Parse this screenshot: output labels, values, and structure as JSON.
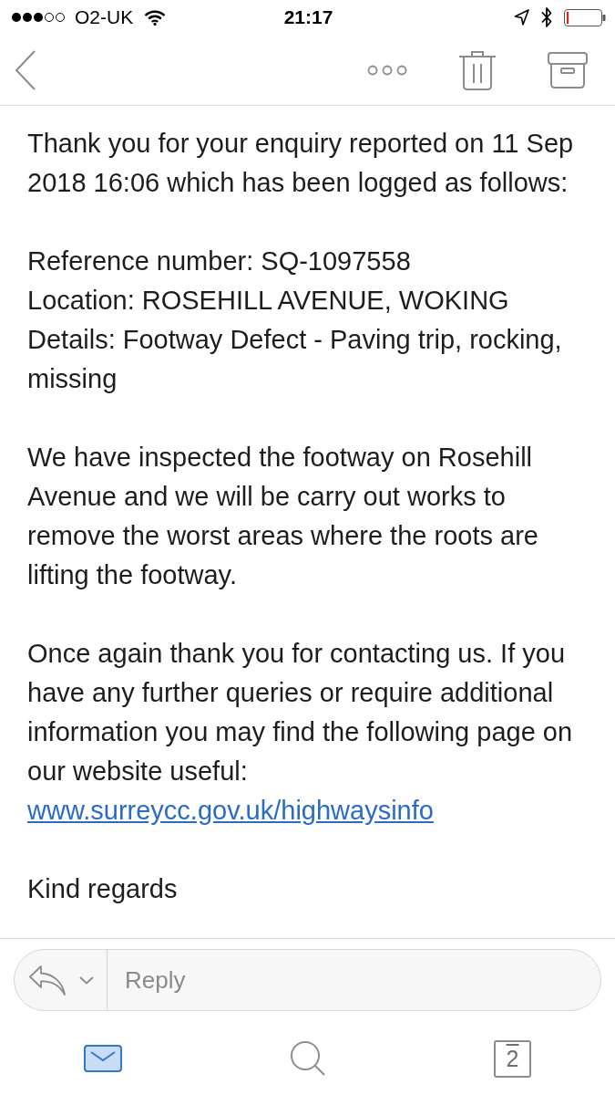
{
  "status_bar": {
    "carrier": "O2-UK",
    "time": "21:17"
  },
  "message": {
    "blocks": [
      {
        "kind": "paragraph",
        "text": "Thank you for your enquiry reported on 11 Sep 2018 16:06 which has been logged as follows:"
      },
      {
        "kind": "lines",
        "lines": [
          "Reference number: SQ-1097558",
          "Location: ROSEHILL AVENUE, WOKING",
          "Details: Footway Defect - Paving trip, rocking, missing"
        ]
      },
      {
        "kind": "paragraph",
        "text": "We have inspected the footway on Rosehill Avenue and we will be carry out works to remove the worst areas where the roots are lifting the footway."
      },
      {
        "kind": "paragraph",
        "text": "Once again thank you for contacting us. If you have any further queries or require additional information you may find the following page on our website useful:",
        "link": "www.surreycc.gov.uk/highwaysinfo"
      },
      {
        "kind": "paragraph",
        "text": "Kind regards"
      }
    ]
  },
  "reply": {
    "placeholder": "Reply"
  },
  "tab_bar": {
    "tabs": [
      {
        "kind": "mail",
        "selected": true
      },
      {
        "kind": "search",
        "selected": false
      },
      {
        "kind": "calendar",
        "label": "2",
        "selected": false
      }
    ]
  }
}
